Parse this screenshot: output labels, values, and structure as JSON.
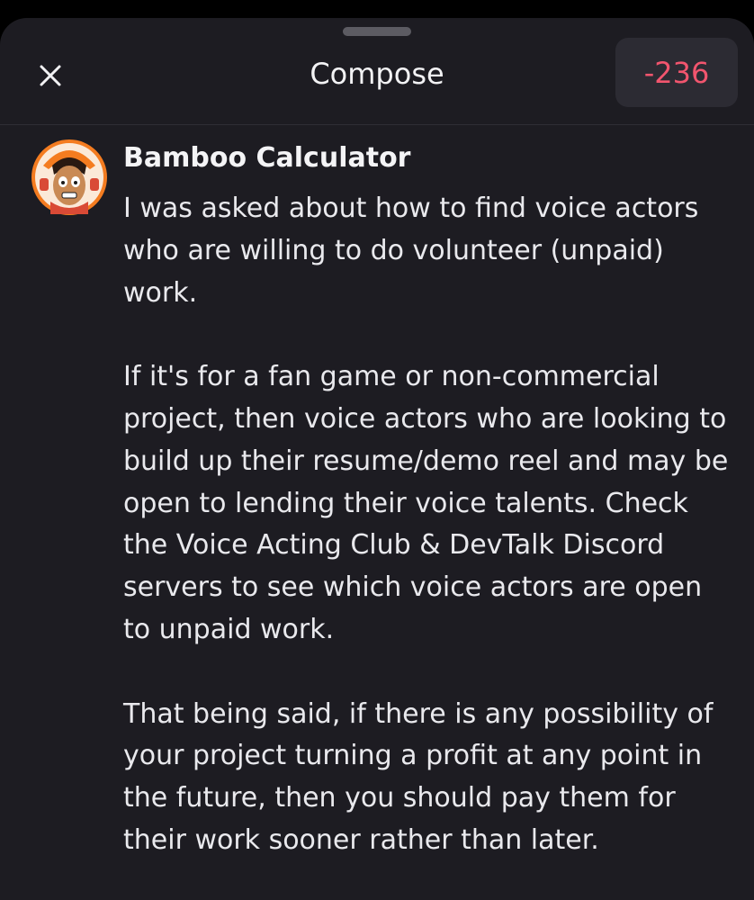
{
  "header": {
    "title": "Compose",
    "char_counter": "-236"
  },
  "post": {
    "author": "Bamboo Calculator",
    "paragraphs": [
      "I was asked about how to find voice actors who are willing to do volunteer (unpaid) work.",
      "If it's for a fan game or non-commercial project, then voice actors who are looking to build up their resume/demo reel and may be open to lending their voice talents. Check the Voice Acting Club & DevTalk Discord servers to see which voice actors are open to unpaid work.",
      "That being said, if there is any possibility of your project turning a profit at any point in the future, then you should pay them for their work sooner rather than later."
    ]
  },
  "icons": {
    "close": "close-icon",
    "avatar": "avatar-cartoon-face"
  },
  "colors": {
    "background": "#1d1c22",
    "counter_over_limit": "#f2556e",
    "text": "#e9e9ed"
  }
}
